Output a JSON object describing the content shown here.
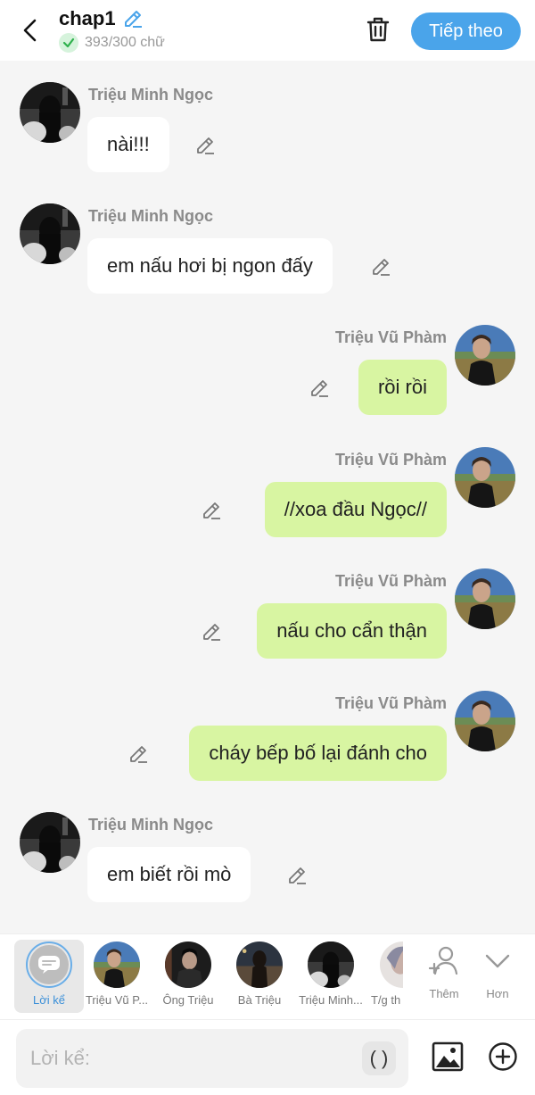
{
  "header": {
    "title": "chap1",
    "word_count": "393/300 chữ",
    "next_label": "Tiếp theo"
  },
  "messages": [
    {
      "side": "left",
      "avatar": "dark",
      "name": "Triệu Minh Ngọc",
      "text": "nài!!!"
    },
    {
      "side": "left",
      "avatar": "dark",
      "name": "Triệu Minh Ngọc",
      "text": "em nấu hơi bị ngon đấy"
    },
    {
      "side": "right",
      "avatar": "field",
      "name": "Triệu Vũ Phàm",
      "text": "rồi rồi"
    },
    {
      "side": "right",
      "avatar": "field",
      "name": "Triệu Vũ Phàm",
      "text": "//xoa đầu Ngọc//"
    },
    {
      "side": "right",
      "avatar": "field",
      "name": "Triệu Vũ Phàm",
      "text": "nấu cho cẩn thận"
    },
    {
      "side": "right",
      "avatar": "field",
      "name": "Triệu Vũ Phàm",
      "text": "cháy bếp bố lại đánh cho"
    },
    {
      "side": "left",
      "avatar": "dark",
      "name": "Triệu Minh Ngọc",
      "text": "em biết rồi mò"
    }
  ],
  "characters": [
    {
      "label": "Lời kể",
      "selected": true,
      "type": "narrator"
    },
    {
      "label": "Triệu Vũ P...",
      "selected": false,
      "type": "field"
    },
    {
      "label": "Ông Triệu",
      "selected": false,
      "type": "dark2"
    },
    {
      "label": "Bà Triệu",
      "selected": false,
      "type": "dark3"
    },
    {
      "label": "Triệu Minh...",
      "selected": false,
      "type": "dark"
    },
    {
      "label": "T/g th",
      "selected": false,
      "type": "light"
    }
  ],
  "tools": {
    "add_label": "Thêm",
    "more_label": "Hơn"
  },
  "input": {
    "placeholder": "Lời kể:",
    "paren_label": "( )"
  },
  "colors": {
    "accent": "#4aa4ea",
    "right_bubble": "#d8f5a2",
    "left_bubble": "#ffffff",
    "name_gray": "#8a8a8a"
  }
}
